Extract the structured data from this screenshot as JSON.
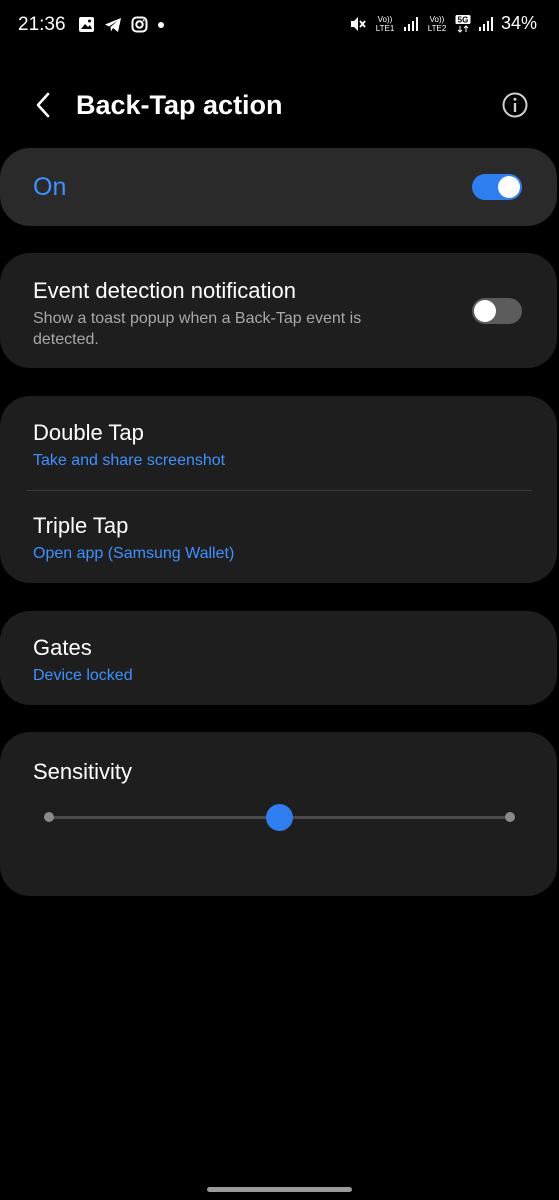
{
  "status_bar": {
    "time": "21:36",
    "left_icons": [
      "gallery-icon",
      "telegram-icon",
      "instagram-icon",
      "dot-icon"
    ],
    "right_icons": [
      "mute-icon",
      "volte-lte1-icon",
      "signal-1-icon",
      "volte-lte2-icon",
      "5g-icon",
      "signal-2-icon"
    ],
    "sim1_label_top": "Vo))",
    "sim1_label_bottom": "LTE1",
    "sim2_label_top": "Vo))",
    "sim2_label_bottom": "LTE2",
    "network_label": "5G",
    "battery": "34%"
  },
  "header": {
    "title": "Back-Tap action",
    "back_icon": "chevron-left-icon",
    "info_icon": "info-icon"
  },
  "master_switch": {
    "label": "On",
    "state": "on"
  },
  "notification": {
    "title": "Event detection notification",
    "subtitle_line1": "Show a toast popup when a Back-Tap event is",
    "subtitle_line2": "detected.",
    "state": "off"
  },
  "taps": [
    {
      "title": "Double Tap",
      "value": "Take and share screenshot"
    },
    {
      "title": "Triple Tap",
      "value": "Open app (Samsung Wallet)"
    }
  ],
  "gates": {
    "title": "Gates",
    "value": "Device locked"
  },
  "sensitivity": {
    "title": "Sensitivity",
    "level": 0.5,
    "steps": 3
  },
  "colors": {
    "accent": "#3e91ff",
    "toggle_on": "#2f7ef0",
    "card": "#1e1e1e",
    "master_card": "#2a2a2a",
    "background": "#000000"
  }
}
